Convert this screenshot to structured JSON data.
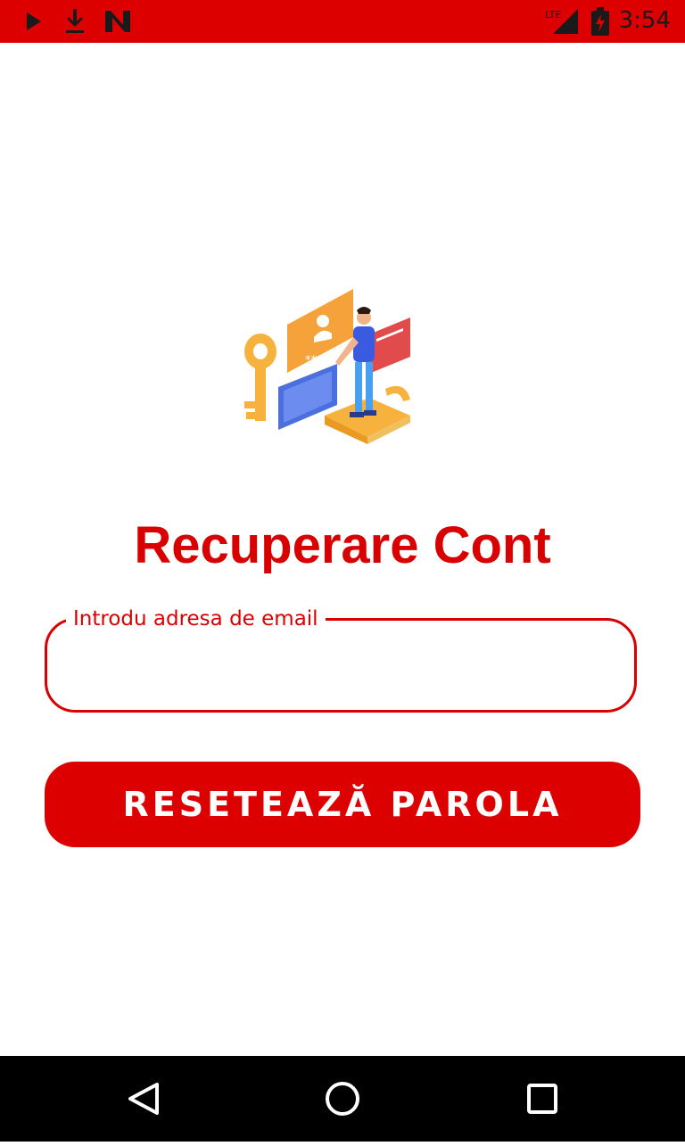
{
  "status_bar": {
    "time": "3:54",
    "network": "LTE",
    "icons": [
      "play-store-icon",
      "download-icon",
      "n-app-icon",
      "lte-signal-icon",
      "battery-charging-icon"
    ]
  },
  "main": {
    "illustration": "account-recovery-illustration",
    "title": "Recuperare Cont",
    "email_label": "Introdu adresa de email",
    "email_value": "",
    "reset_button_label": "RESETEAZĂ PAROLA"
  },
  "nav_bar": {
    "buttons": [
      "back-icon",
      "home-icon",
      "recents-icon"
    ]
  },
  "colors": {
    "accent": "#dd0000",
    "title": "#d80000",
    "background": "#ffffff",
    "nav_bar": "#000000"
  }
}
